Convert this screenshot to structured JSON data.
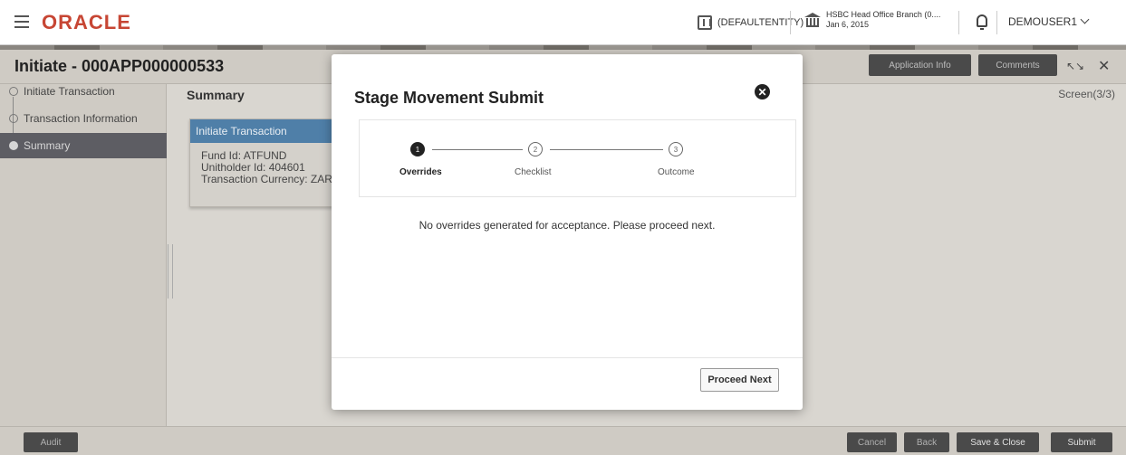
{
  "header": {
    "logo": "ORACLE",
    "entity": "(DEFAULTENTITY)",
    "branch_name": "HSBC Head Office Branch (0....",
    "branch_date": "Jan 6, 2015",
    "user": "DEMOUSER1"
  },
  "titlebar": {
    "title": "Initiate - 000APP000000533",
    "application_info": "Application Info",
    "comments": "Comments",
    "expand_icon": "↖↘",
    "close_icon": "✕"
  },
  "nav": {
    "items": [
      {
        "label": "Initiate Transaction"
      },
      {
        "label": "Transaction Information"
      },
      {
        "label": "Summary"
      }
    ]
  },
  "main": {
    "heading": "Summary",
    "screen": "Screen(3/3)",
    "card": {
      "title": "Initiate Transaction",
      "fund": "Fund Id: ATFUND",
      "unitholder": "Unitholder Id: 404601",
      "currency": "Transaction Currency: ZAR"
    }
  },
  "footer": {
    "audit": "Audit",
    "cancel": "Cancel",
    "back": "Back",
    "save_close": "Save & Close",
    "submit": "Submit"
  },
  "modal": {
    "title": "Stage Movement Submit",
    "close_icon": "✕",
    "steps": [
      {
        "num": "1",
        "label": "Overrides"
      },
      {
        "num": "2",
        "label": "Checklist"
      },
      {
        "num": "3",
        "label": "Outcome"
      }
    ],
    "message": "No overrides generated for acceptance. Please proceed next.",
    "proceed": "Proceed Next"
  }
}
